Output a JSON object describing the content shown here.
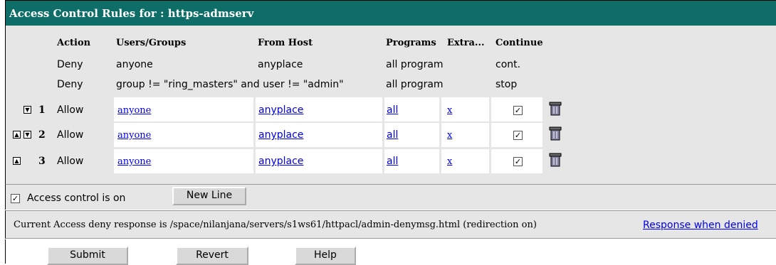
{
  "header": {
    "title": "Access Control Rules for : https-admserv"
  },
  "columns": {
    "action": "Action",
    "users_groups": "Users/Groups",
    "from_host": "From Host",
    "programs": "Programs",
    "extra": "Extra...",
    "continue": "Continue"
  },
  "static_rules": [
    {
      "action": "Deny",
      "users": "anyone",
      "host": "anyplace",
      "programs": "all program",
      "continue": "cont."
    },
    {
      "action": "Deny",
      "users": "group != \"ring_masters\" and user != \"admin\"",
      "host": "",
      "programs": "all program",
      "continue": "stop"
    }
  ],
  "rules": [
    {
      "num": "1",
      "action": "Allow",
      "users": "anyone",
      "host": "anyplace",
      "programs": "all",
      "extra": "x",
      "continue_checked": "☑"
    },
    {
      "num": "2",
      "action": "Allow",
      "users": "anyone",
      "host": "anyplace",
      "programs": "all",
      "extra": "x",
      "continue_checked": "☑"
    },
    {
      "num": "3",
      "action": "Allow",
      "users": "anyone",
      "host": "anyplace",
      "programs": "all",
      "extra": "x",
      "continue_checked": "☑"
    }
  ],
  "controls": {
    "access_control_label": "Access control is on",
    "access_control_checked": true,
    "new_line_button": "New Line"
  },
  "response": {
    "text": "Current Access deny response is /space/nilanjana/servers/s1ws61/httpacl/admin-denymsg.html (redirection on)",
    "link": "Response when denied"
  },
  "footer": {
    "submit": "Submit",
    "revert": "Revert",
    "help": "Help"
  },
  "colors": {
    "header_bg": "#0e6e67",
    "panel_bg": "#e6e6e6",
    "link": "#0000ee"
  }
}
